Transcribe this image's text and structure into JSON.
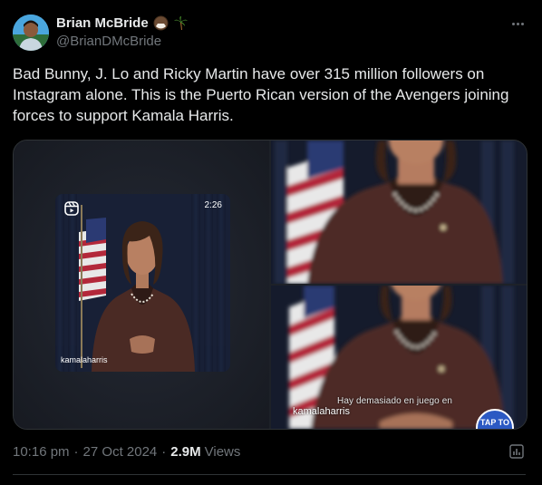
{
  "user": {
    "display_name": "Brian McBride",
    "handle": "@BrianDMcBride",
    "name_emojis": [
      "coconut-emoji",
      "palm-tree-emoji"
    ]
  },
  "tweet": {
    "text": "Bad Bunny, J. Lo and Ricky Martin have over 315 million followers on Instagram alone. This is the Puerto Rican version of the Avengers joining forces to support Kamala Harris."
  },
  "media": {
    "reel": {
      "duration": "2:26",
      "username": "kamalaharris",
      "icon": "reels-icon"
    },
    "bottom_right": {
      "caption": "Hay demasiado en juego en",
      "username": "kamalaharris",
      "badge": "TAP TO"
    }
  },
  "meta": {
    "time": "10:16 pm",
    "separator": "·",
    "date": "27 Oct 2024",
    "views_count": "2.9M",
    "views_label": "Views",
    "analytics_icon": "analytics-icon"
  },
  "colors": {
    "background": "#000000",
    "text_primary": "#e7e9ea",
    "text_secondary": "#71767b",
    "border": "#2f3336",
    "badge_blue": "#2b59c3"
  }
}
